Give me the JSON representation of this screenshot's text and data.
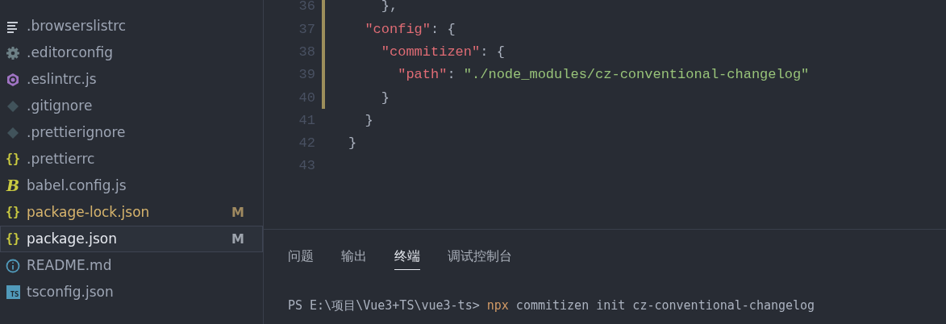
{
  "explorer": {
    "files": [
      {
        "name": ".browserslistrc",
        "kind": "lines",
        "modified": false,
        "selected": false
      },
      {
        "name": ".editorconfig",
        "kind": "gear",
        "modified": false,
        "selected": false
      },
      {
        "name": ".eslintrc.js",
        "kind": "hexagon",
        "modified": false,
        "selected": false
      },
      {
        "name": ".gitignore",
        "kind": "diamond",
        "modified": false,
        "selected": false
      },
      {
        "name": ".prettierignore",
        "kind": "diamond",
        "modified": false,
        "selected": false
      },
      {
        "name": ".prettierrc",
        "kind": "braces",
        "glyph": "{}",
        "modified": false,
        "selected": false
      },
      {
        "name": "babel.config.js",
        "kind": "babel",
        "glyph": "B",
        "modified": false,
        "selected": false
      },
      {
        "name": "package-lock.json",
        "kind": "braces",
        "glyph": "{}",
        "modified": true,
        "badge": "M",
        "selected": false
      },
      {
        "name": "package.json",
        "kind": "braces",
        "glyph": "{}",
        "modified": true,
        "badge": "M",
        "selected": true
      },
      {
        "name": "README.md",
        "kind": "info",
        "modified": false,
        "selected": false
      },
      {
        "name": "tsconfig.json",
        "kind": "ts",
        "glyph": "TS",
        "modified": false,
        "selected": false
      }
    ]
  },
  "editor": {
    "lines": [
      {
        "number": "36",
        "modified": true,
        "tokens": [
          {
            "kind": "punct",
            "text": "    },"
          }
        ]
      },
      {
        "number": "37",
        "modified": true,
        "tokens": [
          {
            "kind": "key",
            "text": "  \"config\""
          },
          {
            "kind": "punct",
            "text": ": {"
          }
        ]
      },
      {
        "number": "38",
        "modified": true,
        "tokens": [
          {
            "kind": "key",
            "text": "    \"commitizen\""
          },
          {
            "kind": "punct",
            "text": ": {"
          }
        ]
      },
      {
        "number": "39",
        "modified": true,
        "tokens": [
          {
            "kind": "key",
            "text": "      \"path\""
          },
          {
            "kind": "punct",
            "text": ": "
          },
          {
            "kind": "string",
            "text": "\"./node_modules/cz-conventional-changelog\""
          }
        ]
      },
      {
        "number": "40",
        "modified": true,
        "tokens": [
          {
            "kind": "punct",
            "text": "    }"
          }
        ]
      },
      {
        "number": "41",
        "modified": false,
        "tokens": [
          {
            "kind": "punct",
            "text": "  }"
          }
        ]
      },
      {
        "number": "42",
        "modified": false,
        "tokens": [
          {
            "kind": "punct",
            "text": "}"
          }
        ]
      },
      {
        "number": "43",
        "modified": false
      }
    ]
  },
  "panel": {
    "tabs": [
      {
        "label": "问题",
        "selected": false
      },
      {
        "label": "输出",
        "selected": false
      },
      {
        "label": "终端",
        "selected": true
      },
      {
        "label": "调试控制台",
        "selected": false
      }
    ],
    "terminal": {
      "prompt": "PS E:\\项目\\Vue3+TS\\vue3-ts>",
      "command": "npx",
      "arguments": "commitizen init cz-conventional-changelog"
    }
  }
}
